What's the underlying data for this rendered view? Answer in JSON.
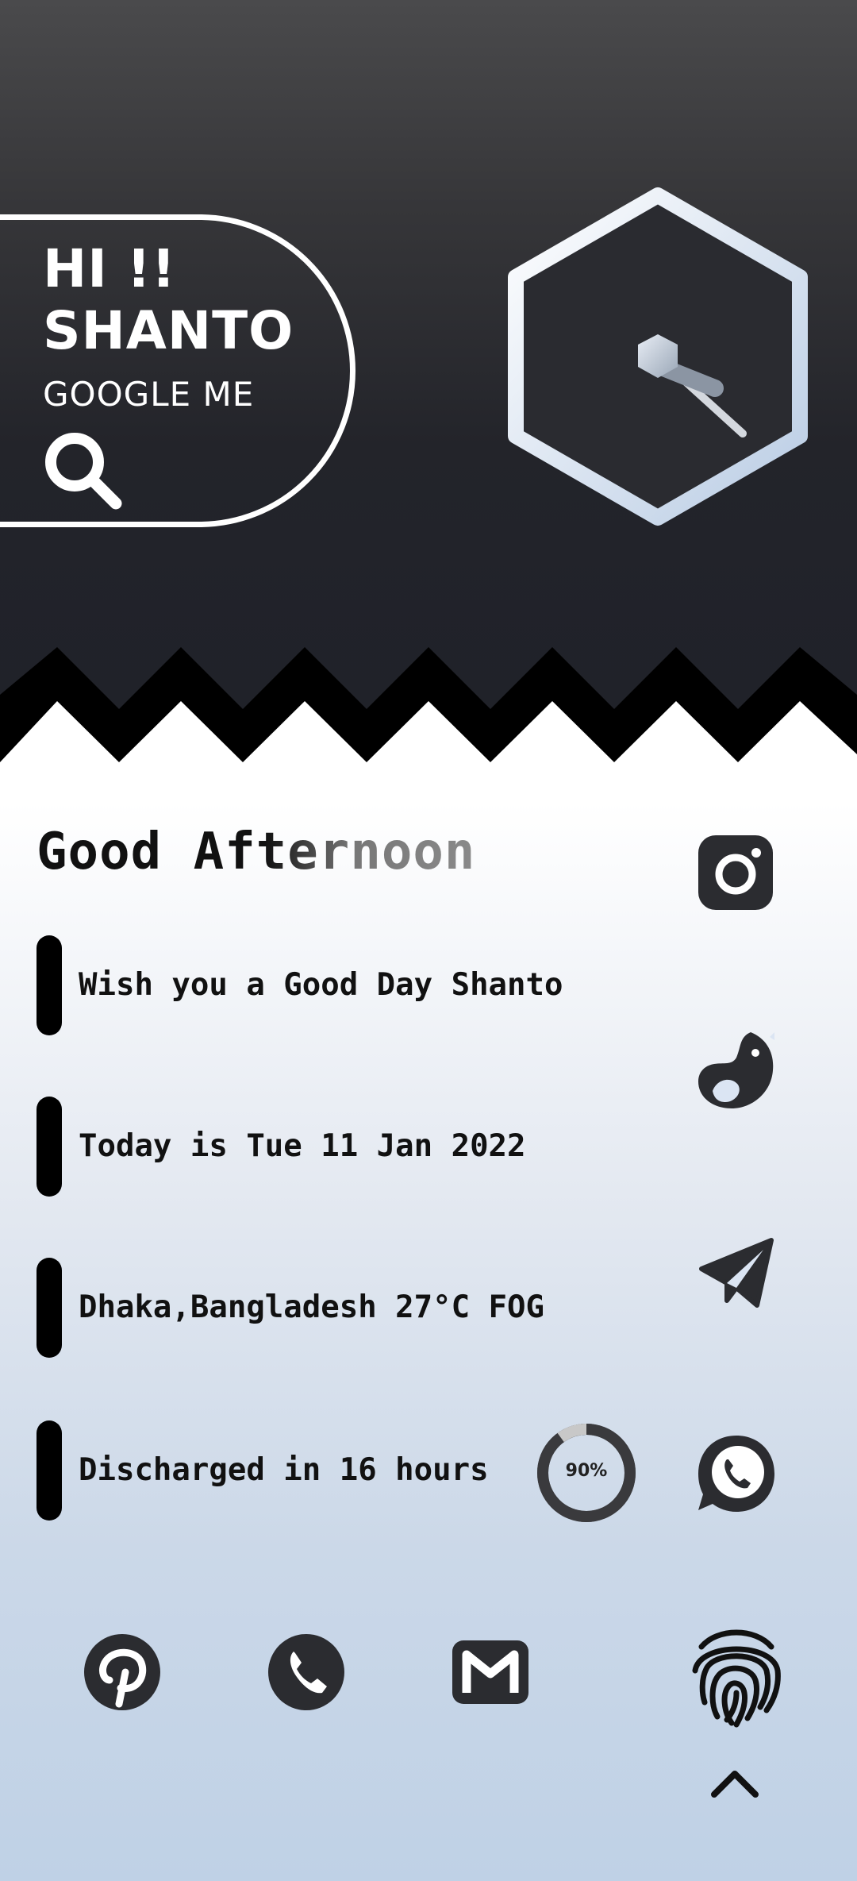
{
  "header": {
    "greeting_line1": "HI !!",
    "greeting_line2": "SHANTO",
    "search_label": "GOOGLE ME"
  },
  "main": {
    "greeting": "Good Afternoon",
    "rows": [
      {
        "text": "Wish you a Good Day Shanto"
      },
      {
        "text": "Today is Tue 11 Jan 2022"
      },
      {
        "text": "Dhaka,Bangladesh 27°C FOG"
      },
      {
        "text": "Discharged in 16 hours"
      }
    ],
    "battery": {
      "label": "90%",
      "percent": 90
    }
  },
  "icons": {
    "right_column": [
      "instagram-icon",
      "bird-icon",
      "telegram-icon",
      "whatsapp-icon"
    ],
    "dock": [
      "pinterest-icon",
      "phone-icon",
      "gmail-icon",
      "fingerprint-icon"
    ],
    "bottom": "chevron-up-icon"
  },
  "colors": {
    "top_band": "#23242a",
    "accent_light": "#dbe5f3",
    "text_dark": "#111111",
    "icon_dark": "#2b2c30"
  }
}
